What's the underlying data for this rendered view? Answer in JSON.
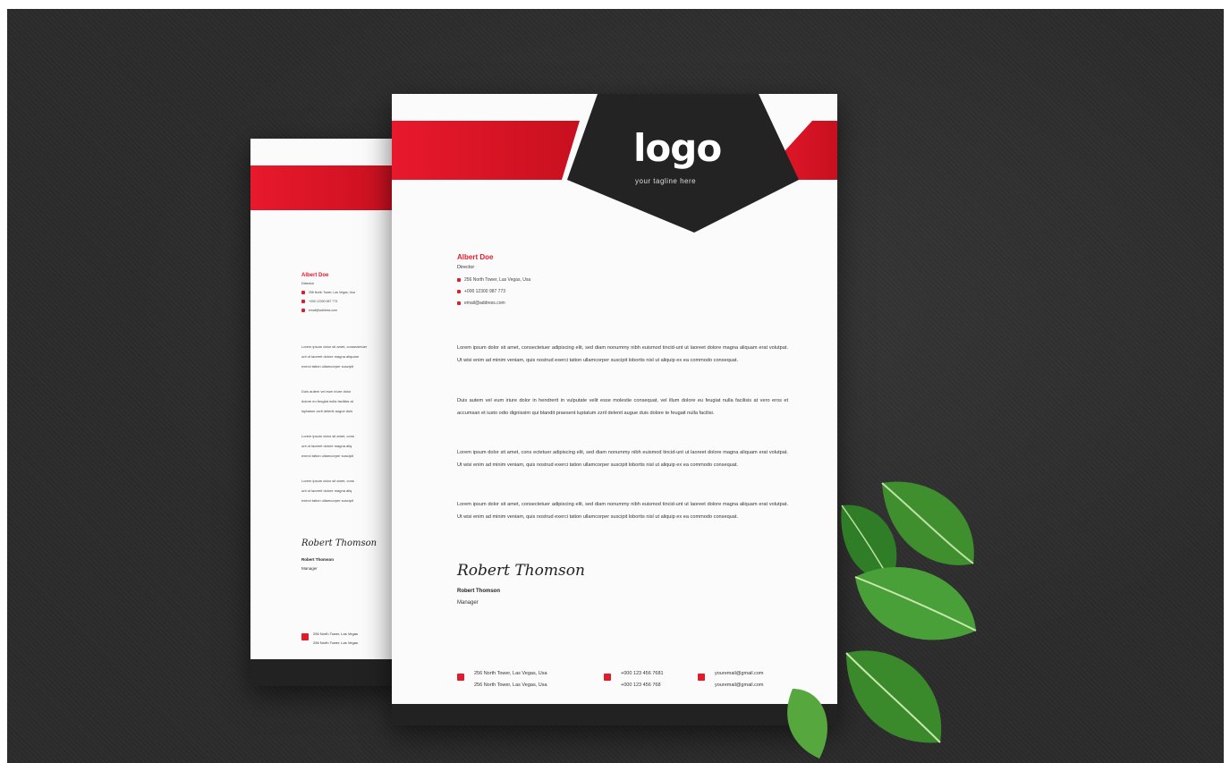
{
  "brand": {
    "logo": "logo",
    "tagline": "your tagline here"
  },
  "colors": {
    "accent": "#e21b2b",
    "dark": "#222222",
    "background": "#2b2b2b",
    "paper": "#fbfbfb"
  },
  "sender": {
    "name": "Albert Doe",
    "title": "Director",
    "address": "256 North Tower, Las Vegas, Usa",
    "phone": "+000 12300 987 773",
    "email": "email@address.com"
  },
  "paragraphs": [
    "Lorem ipsum dolor sit amet, consectetuer adipiscing elit, sed diam nonummy nibh euismod tincid-unt ut laoreet dolore magna aliquam erat volutpat. Ut wisi enim ad minim veniam, quis nostrud exerci tation ullamcorper suscipit lobortis nisl ut aliquip ex ea commodo consequat.",
    "Duis autem vel eum iriure dolor in hendrerit in vulputate velit esse molestie consequat, vel illum dolore eu feugiat nulla facilisis at vero eros et accumsan et iusto odio dignissim qui blandit praesent luptatum zzril delenit augue duis dolore te feugait nulla facilisi.",
    "Lorem ipsum dolor sit amet, cons ectetuer adipiscing elit, sed diam nonummy nibh euismod tincid-unt ut laoreet dolore magna aliquam erat volutpat. Ut wisi enim ad minim veniam, quis nostrud exerci tation ullamcorper suscipit lobortis nisl ut aliquip ex ea commodo consequat.",
    "Lorem ipsum dolor sit amet, consectetuer adipiscing elit, sed diam nonummy nibh euismod tincid-unt ut laoreet dolore magna aliquam erat volutpat. Ut wisi enim ad minim veniam, quis nostrud exerci tation ullamcorper suscipit lobortis nisl ut aliquip ex ea commodo consequat."
  ],
  "signature": {
    "script": "Robert Thomson",
    "name": "Robert Thomson",
    "role": "Manager"
  },
  "footer": {
    "address_lines": [
      "256 North Tower, Las Vegas, Usa",
      "256 North Tower, Las Vegas, Usa"
    ],
    "phone_lines": [
      "+000 123 456 7681",
      "+000 123 456 768"
    ],
    "email_lines": [
      "youremail@gmail.com",
      "youremail@gmail.com"
    ],
    "icons": [
      "location-icon",
      "phone-icon",
      "mail-icon"
    ]
  },
  "back_sheet": {
    "name": "Albert Doe",
    "title": "Director",
    "address": "256 North Tower, Las Vegas, Usa",
    "phone": "+000 12300 987 773",
    "email": "email@address.com",
    "snippets": [
      "Lorem ipsum dolor sit amet, consectetuer",
      "unt ut laoreet dolore magna aliquam",
      "exerci tation ullamcorper suscipit",
      "Duis autem vel eum iriure dolor",
      "dolore eu feugiat nulla facilisis at",
      "luptatum zzril delenit augue duis",
      "Lorem ipsum dolor sit amet, cons",
      "unt ut laoreet dolore magna aliq",
      "exerci tation ullamcorper suscipit",
      "Lorem ipsum dolor sit amet, cons",
      "unt ut laoreet dolore magna aliq",
      "exerci tation ullamcorper suscipit"
    ],
    "signature_script": "Robert Thomson",
    "signature_name": "Robert Thomson",
    "signature_role": "Manager",
    "footer_lines": [
      "256 North Tower, Las Vegas",
      "256 North Tower, Las Vegas"
    ]
  }
}
